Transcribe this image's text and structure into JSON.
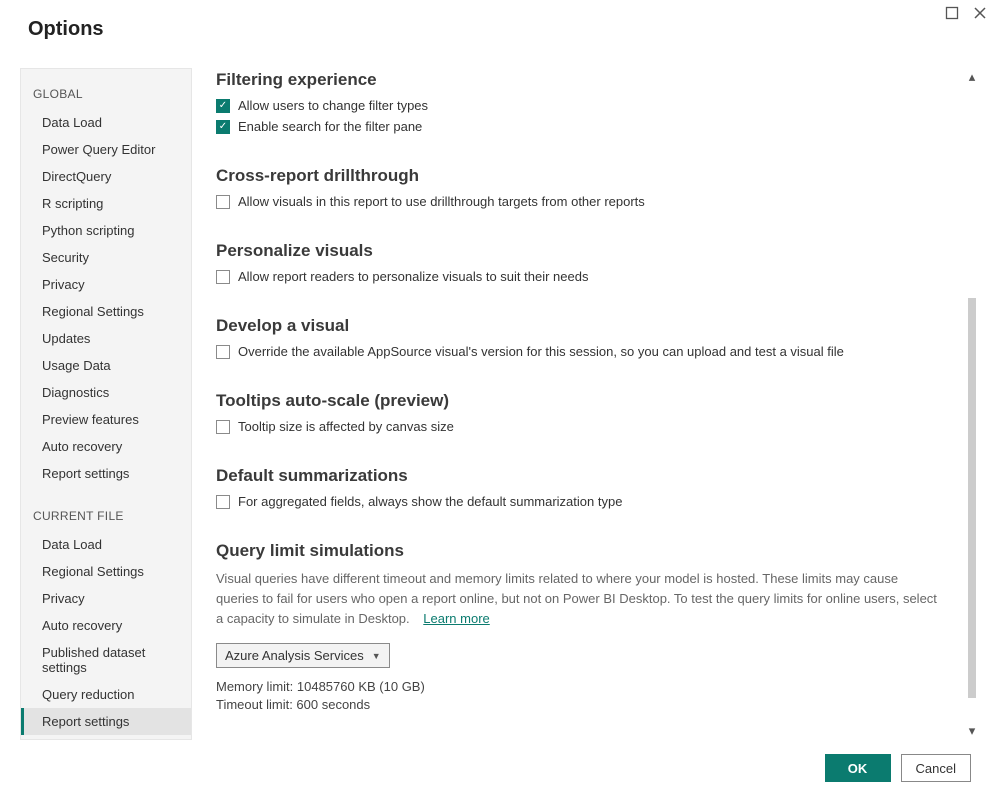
{
  "title": "Options",
  "sidebar": {
    "global_header": "GLOBAL",
    "global_items": [
      "Data Load",
      "Power Query Editor",
      "DirectQuery",
      "R scripting",
      "Python scripting",
      "Security",
      "Privacy",
      "Regional Settings",
      "Updates",
      "Usage Data",
      "Diagnostics",
      "Preview features",
      "Auto recovery",
      "Report settings"
    ],
    "current_header": "CURRENT FILE",
    "current_items": [
      "Data Load",
      "Regional Settings",
      "Privacy",
      "Auto recovery",
      "Published dataset settings",
      "Query reduction",
      "Report settings"
    ],
    "selected": "Report settings"
  },
  "sections": {
    "filtering": {
      "heading": "Filtering experience",
      "chk1_label": "Allow users to change filter types",
      "chk2_label": "Enable search for the filter pane"
    },
    "cross": {
      "heading": "Cross-report drillthrough",
      "chk_label": "Allow visuals in this report to use drillthrough targets from other reports"
    },
    "personalize": {
      "heading": "Personalize visuals",
      "chk_label": "Allow report readers to personalize visuals to suit their needs"
    },
    "develop": {
      "heading": "Develop a visual",
      "chk_label": "Override the available AppSource visual's version for this session, so you can upload and test a visual file"
    },
    "tooltips": {
      "heading": "Tooltips auto-scale (preview)",
      "chk_label": "Tooltip size is affected by canvas size"
    },
    "defaults": {
      "heading": "Default summarizations",
      "chk_label": "For aggregated fields, always show the default summarization type"
    },
    "query": {
      "heading": "Query limit simulations",
      "desc": "Visual queries have different timeout and memory limits related to where your model is hosted. These limits may cause queries to fail for users who open a report online, but not on Power BI Desktop. To test the query limits for online users, select a capacity to simulate in Desktop.",
      "learn_more": "Learn more",
      "dropdown_value": "Azure Analysis Services",
      "memory_limit": "Memory limit: 10485760 KB (10 GB)",
      "timeout_limit": "Timeout limit: 600 seconds"
    }
  },
  "footer": {
    "ok": "OK",
    "cancel": "Cancel"
  }
}
